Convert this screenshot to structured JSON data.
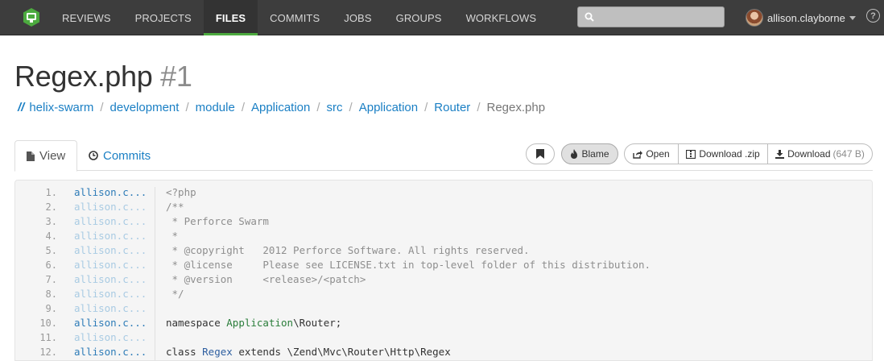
{
  "nav": {
    "items": [
      {
        "label": "REVIEWS",
        "active": false
      },
      {
        "label": "PROJECTS",
        "active": false
      },
      {
        "label": "FILES",
        "active": true
      },
      {
        "label": "COMMITS",
        "active": false
      },
      {
        "label": "JOBS",
        "active": false
      },
      {
        "label": "GROUPS",
        "active": false
      },
      {
        "label": "WORKFLOWS",
        "active": false
      }
    ],
    "search_value": "",
    "user": "allison.clayborne",
    "help": "?",
    "accent": "#4caa3f"
  },
  "page": {
    "file_name": "Regex.php",
    "revision": "#1"
  },
  "breadcrumb": {
    "root": "//",
    "parts": [
      "helix-swarm",
      "development",
      "module",
      "Application",
      "src",
      "Application",
      "Router"
    ],
    "current": "Regex.php"
  },
  "tabs": {
    "view": "View",
    "commits": "Commits"
  },
  "actions": {
    "blame": "Blame",
    "open": "Open",
    "download_zip": "Download .zip",
    "download": "Download",
    "download_size": "(647 B)"
  },
  "code": {
    "lines": [
      {
        "n": "1.",
        "author": "allison.c...",
        "faded": false,
        "segments": [
          {
            "t": "<?php",
            "c": "cm"
          }
        ]
      },
      {
        "n": "2.",
        "author": "allison.c...",
        "faded": true,
        "segments": [
          {
            "t": "/**",
            "c": "cm"
          }
        ]
      },
      {
        "n": "3.",
        "author": "allison.c...",
        "faded": true,
        "segments": [
          {
            "t": " * Perforce Swarm",
            "c": "cm"
          }
        ]
      },
      {
        "n": "4.",
        "author": "allison.c...",
        "faded": true,
        "segments": [
          {
            "t": " *",
            "c": "cm"
          }
        ]
      },
      {
        "n": "5.",
        "author": "allison.c...",
        "faded": true,
        "segments": [
          {
            "t": " * @copyright   2012 Perforce Software. All rights reserved.",
            "c": "cm"
          }
        ]
      },
      {
        "n": "6.",
        "author": "allison.c...",
        "faded": true,
        "segments": [
          {
            "t": " * @license     Please see LICENSE.txt in top-level folder of this distribution.",
            "c": "cm"
          }
        ]
      },
      {
        "n": "7.",
        "author": "allison.c...",
        "faded": true,
        "segments": [
          {
            "t": " * @version     <release>/<patch>",
            "c": "cm"
          }
        ]
      },
      {
        "n": "8.",
        "author": "allison.c...",
        "faded": true,
        "segments": [
          {
            "t": " */",
            "c": "cm"
          }
        ]
      },
      {
        "n": "9.",
        "author": "allison.c...",
        "faded": true,
        "segments": [
          {
            "t": "",
            "c": "kw"
          }
        ]
      },
      {
        "n": "10.",
        "author": "allison.c...",
        "faded": false,
        "segments": [
          {
            "t": "namespace ",
            "c": "kw"
          },
          {
            "t": "Application",
            "c": "ns"
          },
          {
            "t": "\\Router;",
            "c": "kw"
          }
        ]
      },
      {
        "n": "11.",
        "author": "allison.c...",
        "faded": true,
        "segments": [
          {
            "t": "",
            "c": "kw"
          }
        ]
      },
      {
        "n": "12.",
        "author": "allison.c...",
        "faded": false,
        "segments": [
          {
            "t": "class ",
            "c": "kw"
          },
          {
            "t": "Regex",
            "c": "cls"
          },
          {
            "t": " extends \\Zend\\Mvc\\Router\\Http\\Regex",
            "c": "kw"
          }
        ]
      }
    ]
  }
}
